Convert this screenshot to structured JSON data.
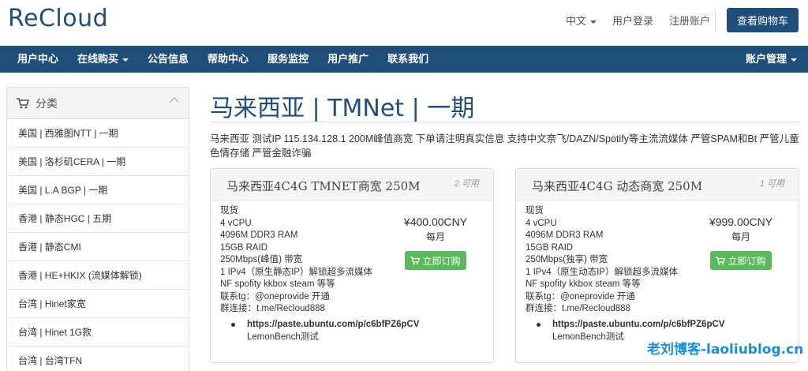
{
  "header": {
    "logo": "ReCloud",
    "language": "中文",
    "login": "用户登录",
    "register": "注册账户",
    "cart_button": "查看购物车"
  },
  "nav": {
    "items": [
      "用户中心",
      "在线购买",
      "公告信息",
      "帮助中心",
      "服务监控",
      "用户推广",
      "联系我们"
    ],
    "dropdown_items": [
      "在线购买"
    ],
    "account": "账户管理"
  },
  "sidebar": {
    "heading": "分类",
    "items": [
      "美国 | 西雅图NTT | 一期",
      "美国 | 洛杉矶CERA | 一期",
      "美国 | L.A BGP | 一期",
      "香港 | 静态HGC | 五期",
      "香港 | 静态CMI",
      "香港 | HE+HKIX (流媒体解锁)",
      "台湾 | Hinet家宽",
      "台湾 | Hinet 1G款",
      "台湾 | 台湾TFN"
    ]
  },
  "main": {
    "title": "马来西亚 | TMNet | 一期",
    "description": "马来西亚 测试IP 115.134.128.1 200M峰值商宽 下单请注明真实信息 支持中文奈飞/DAZN/Spotify等主流流媒体 严管SPAM和Bt 严管儿童色情存储 严管金融诈骗"
  },
  "products": [
    {
      "name": "马来西亚4C4G TMNET商宽 250M",
      "availability": "2 可用",
      "specs": [
        "现货",
        "4 vCPU",
        "4096M DDR3 RAM",
        "15GB RAID",
        "250Mbps(峰值) 带宽",
        "1 IPv4（原生静态IP）解锁超多流媒体",
        "NF spofity kkbox steam 等等",
        "联系tg：@oneprovide 开通",
        "群连接：t.me/Recloud888"
      ],
      "link": "https://paste.ubuntu.com/p/c6bfPZ6pCV",
      "link_note": "LemonBench测试",
      "price": "¥400.00CNY",
      "cycle": "每月",
      "order_label": "立即订购"
    },
    {
      "name": "马来西亚4C4G 动态商宽 250M",
      "availability": "1 可用",
      "specs": [
        "现货",
        "4 vCPU",
        "4096M DDR3 RAM",
        "15GB RAID",
        "250Mbps(独享) 带宽",
        "1 IPv4（原生动态IP）解锁超多流媒体",
        "NF spofity kkbox steam 等等",
        "联系tg：@oneprovide 开通",
        "群连接：t.me/Recloud888"
      ],
      "link": "https://paste.ubuntu.com/p/c6bfPZ6pCV",
      "link_note": "LemonBench测试",
      "price": "¥999.00CNY",
      "cycle": "每月",
      "order_label": "立即订购"
    }
  ],
  "watermark": "老刘博客-laoliublog.cn",
  "colors": {
    "brand": "#1e4e79",
    "order_button": "#5cb85c",
    "watermark": "#1a8fd8"
  }
}
